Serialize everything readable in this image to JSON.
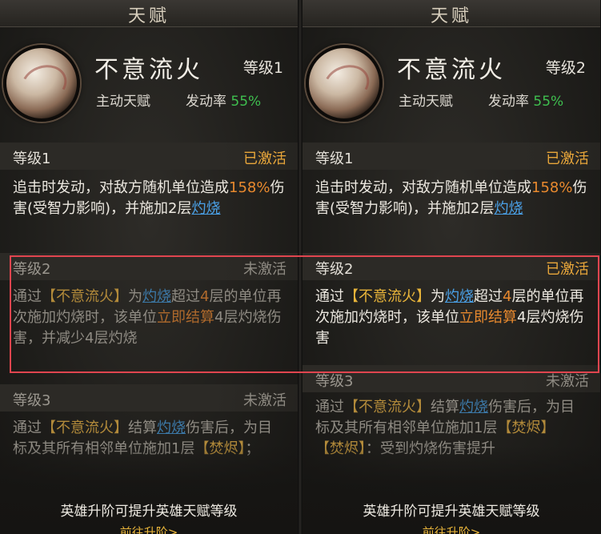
{
  "header": {
    "title": "天赋"
  },
  "skill": {
    "name": "不意流火",
    "type": "主动天赋",
    "rate_label": "发动率",
    "rate_value": "55%"
  },
  "panels": [
    {
      "level_label": "等级1",
      "levels": [
        {
          "label": "等级1",
          "status": "已激活"
        },
        {
          "label": "等级2",
          "status": "未激活"
        },
        {
          "label": "等级3",
          "status": "未激活"
        }
      ]
    },
    {
      "level_label": "等级2",
      "levels": [
        {
          "label": "等级1",
          "status": "已激活"
        },
        {
          "label": "等级2",
          "status": "已激活"
        },
        {
          "label": "等级3",
          "status": "未激活"
        }
      ]
    }
  ],
  "text": {
    "l1_a": "追击时发动，对敌方随机单位造成",
    "l1_pct": "158%",
    "l1_b": "伤害(受智力影响)，并施加2层",
    "burn": "灼烧",
    "via": "通过",
    "skill_tag": "【不意流火】",
    "for": "为",
    "exceed": "超过",
    "four": "4",
    "layer": "层",
    "l2_b": "的单位再次施加灼烧时，该单位",
    "instant_settle": "立即结算",
    "l2_c_left": "4层灼烧伤害，并减少4层灼烧",
    "l2_c_right": "4层灼烧伤害",
    "settle": "结算",
    "l3_a_tail": "伤害后，为目标及其所有相邻单位施加1层",
    "ember_tag": "【焚烬】",
    "l3_semicolon": "；",
    "l3_right_tail": "：受到灼烧伤害提升"
  },
  "footer": {
    "hint": "英雄升阶可提升英雄天赋等级",
    "goto": "前往升阶>"
  },
  "colors": {
    "active": "#e8a63a",
    "inactive": "#8e8a82",
    "highlight": "#e0454f",
    "rate": "#3fbf4f",
    "link": "#4aa0e6"
  }
}
